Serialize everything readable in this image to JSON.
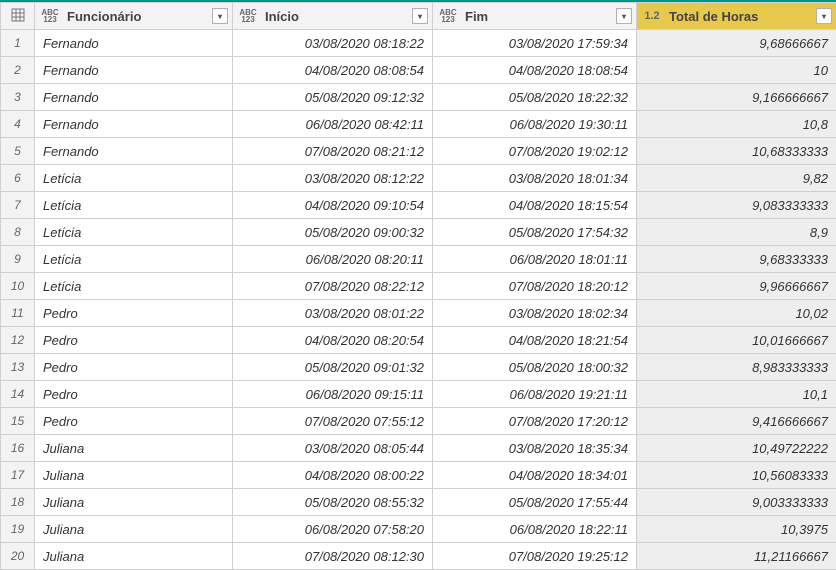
{
  "columns": {
    "funcionario": {
      "label": "Funcionário",
      "type": "ABC123"
    },
    "inicio": {
      "label": "Início",
      "type": "ABC123"
    },
    "fim": {
      "label": "Fim",
      "type": "ABC123"
    },
    "total": {
      "label": "Total de Horas",
      "type": "1.2"
    }
  },
  "rows": [
    {
      "n": "1",
      "funcionario": "Fernando",
      "inicio": "03/08/2020 08:18:22",
      "fim": "03/08/2020 17:59:34",
      "total": "9,68666667"
    },
    {
      "n": "2",
      "funcionario": "Fernando",
      "inicio": "04/08/2020 08:08:54",
      "fim": "04/08/2020 18:08:54",
      "total": "10"
    },
    {
      "n": "3",
      "funcionario": "Fernando",
      "inicio": "05/08/2020 09:12:32",
      "fim": "05/08/2020 18:22:32",
      "total": "9,166666667"
    },
    {
      "n": "4",
      "funcionario": "Fernando",
      "inicio": "06/08/2020 08:42:11",
      "fim": "06/08/2020 19:30:11",
      "total": "10,8"
    },
    {
      "n": "5",
      "funcionario": "Fernando",
      "inicio": "07/08/2020 08:21:12",
      "fim": "07/08/2020 19:02:12",
      "total": "10,68333333"
    },
    {
      "n": "6",
      "funcionario": "Letícia",
      "inicio": "03/08/2020 08:12:22",
      "fim": "03/08/2020 18:01:34",
      "total": "9,82"
    },
    {
      "n": "7",
      "funcionario": "Letícia",
      "inicio": "04/08/2020 09:10:54",
      "fim": "04/08/2020 18:15:54",
      "total": "9,083333333"
    },
    {
      "n": "8",
      "funcionario": "Letícia",
      "inicio": "05/08/2020 09:00:32",
      "fim": "05/08/2020 17:54:32",
      "total": "8,9"
    },
    {
      "n": "9",
      "funcionario": "Letícia",
      "inicio": "06/08/2020 08:20:11",
      "fim": "06/08/2020 18:01:11",
      "total": "9,68333333"
    },
    {
      "n": "10",
      "funcionario": "Letícia",
      "inicio": "07/08/2020 08:22:12",
      "fim": "07/08/2020 18:20:12",
      "total": "9,96666667"
    },
    {
      "n": "11",
      "funcionario": "Pedro",
      "inicio": "03/08/2020 08:01:22",
      "fim": "03/08/2020 18:02:34",
      "total": "10,02"
    },
    {
      "n": "12",
      "funcionario": "Pedro",
      "inicio": "04/08/2020 08:20:54",
      "fim": "04/08/2020 18:21:54",
      "total": "10,01666667"
    },
    {
      "n": "13",
      "funcionario": "Pedro",
      "inicio": "05/08/2020 09:01:32",
      "fim": "05/08/2020 18:00:32",
      "total": "8,983333333"
    },
    {
      "n": "14",
      "funcionario": "Pedro",
      "inicio": "06/08/2020 09:15:11",
      "fim": "06/08/2020 19:21:11",
      "total": "10,1"
    },
    {
      "n": "15",
      "funcionario": "Pedro",
      "inicio": "07/08/2020 07:55:12",
      "fim": "07/08/2020 17:20:12",
      "total": "9,416666667"
    },
    {
      "n": "16",
      "funcionario": "Juliana",
      "inicio": "03/08/2020 08:05:44",
      "fim": "03/08/2020 18:35:34",
      "total": "10,49722222"
    },
    {
      "n": "17",
      "funcionario": "Juliana",
      "inicio": "04/08/2020 08:00:22",
      "fim": "04/08/2020 18:34:01",
      "total": "10,56083333"
    },
    {
      "n": "18",
      "funcionario": "Juliana",
      "inicio": "05/08/2020 08:55:32",
      "fim": "05/08/2020 17:55:44",
      "total": "9,003333333"
    },
    {
      "n": "19",
      "funcionario": "Juliana",
      "inicio": "06/08/2020 07:58:20",
      "fim": "06/08/2020 18:22:11",
      "total": "10,3975"
    },
    {
      "n": "20",
      "funcionario": "Juliana",
      "inicio": "07/08/2020 08:12:30",
      "fim": "07/08/2020 19:25:12",
      "total": "11,21166667"
    }
  ]
}
